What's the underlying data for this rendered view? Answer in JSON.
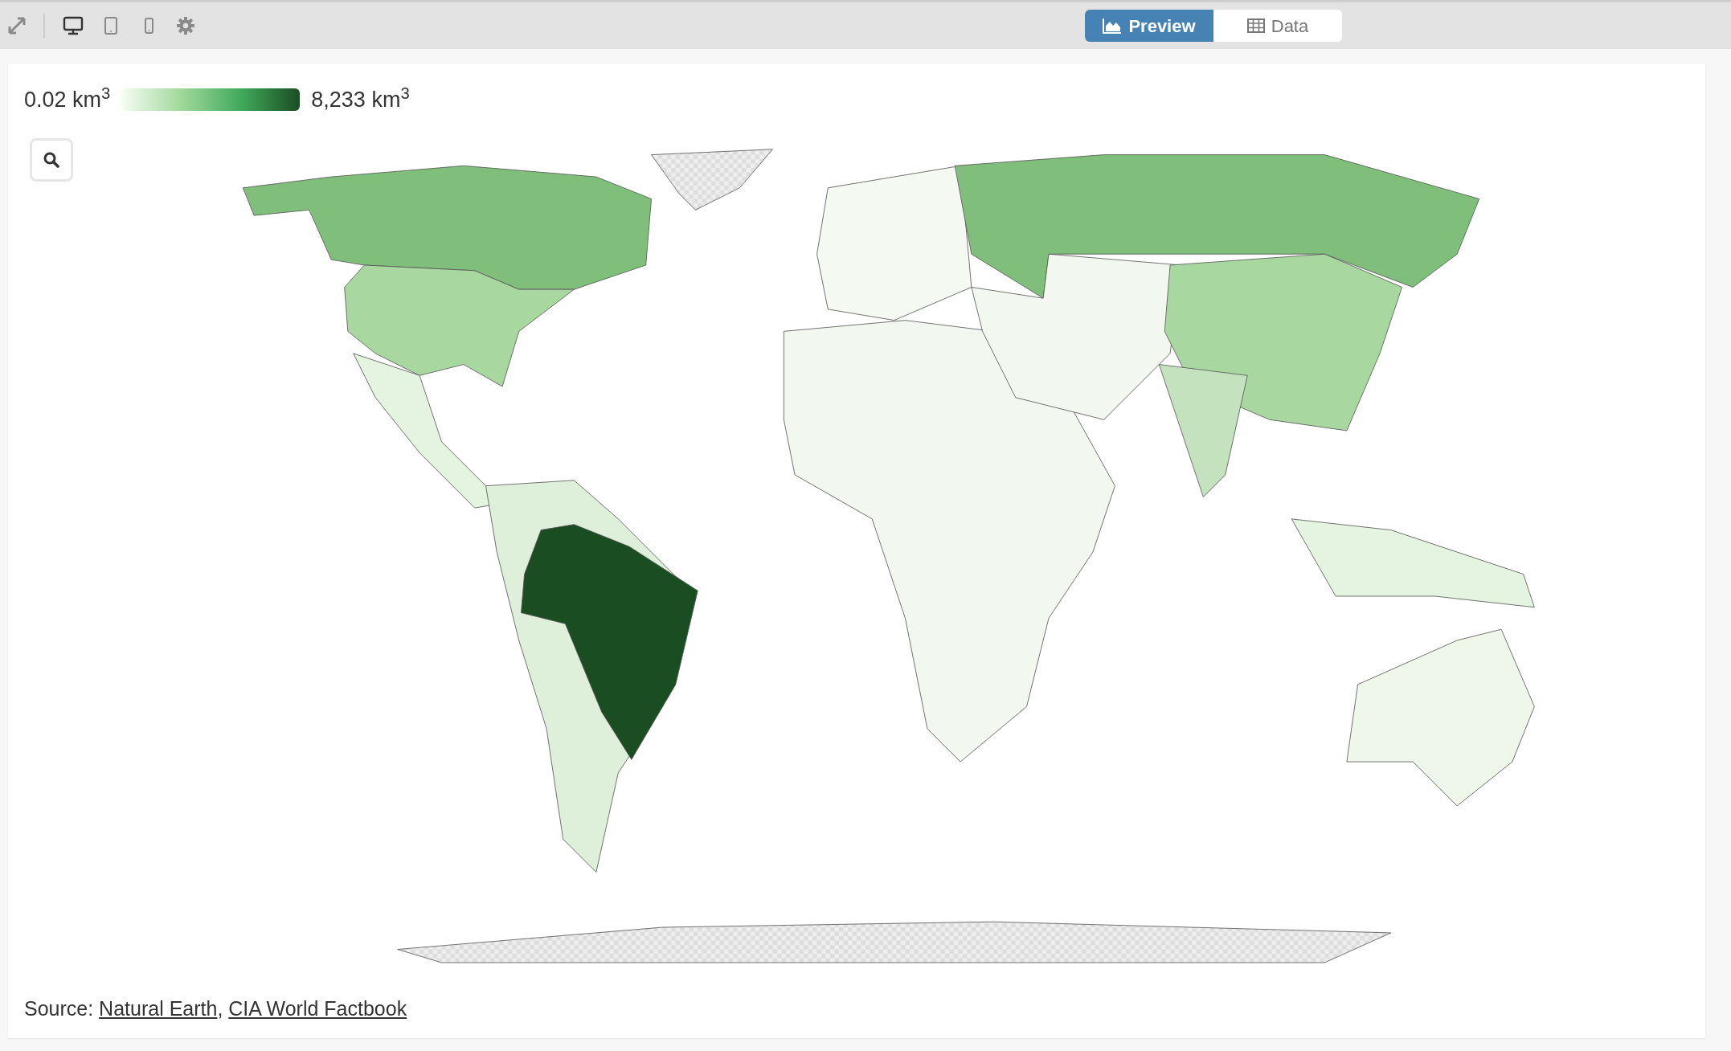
{
  "toolbar": {
    "devices": [
      {
        "kind": "desktop",
        "selected": true
      },
      {
        "kind": "tablet",
        "selected": false
      },
      {
        "kind": "phone",
        "selected": false
      }
    ]
  },
  "view_tabs": [
    {
      "label": "Preview",
      "kind": "chart",
      "selected": true
    },
    {
      "label": "Data",
      "kind": "table",
      "selected": false
    }
  ],
  "legend": {
    "min": "0.02 km$^{3}$",
    "max": "8,233 km$^{3}$"
  },
  "source": {
    "prefix": "Source:",
    "separator": ",",
    "links": [
      "Natural Earth",
      "CIA World Factbook"
    ]
  }
}
